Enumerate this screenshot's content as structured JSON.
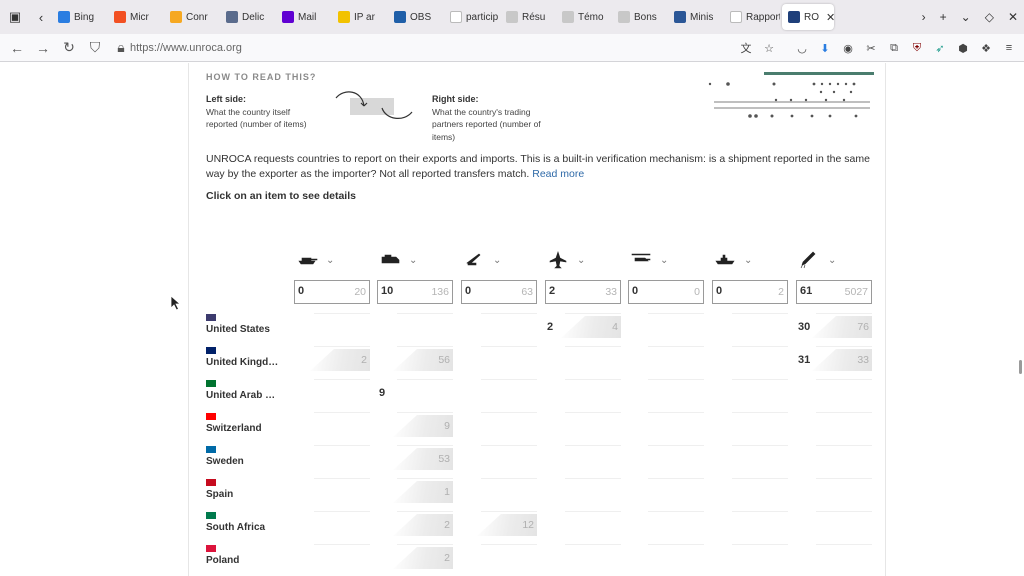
{
  "browser": {
    "tabs": [
      {
        "label": "Bing",
        "color": "#2a7de1"
      },
      {
        "label": "Micr",
        "color": "#f25022"
      },
      {
        "label": "Conr",
        "color": "#f6a821"
      },
      {
        "label": "Delic",
        "color": "#5a6b8c"
      },
      {
        "label": "Mail",
        "color": "#6001d2"
      },
      {
        "label": "IP ar",
        "color": "#f2c200"
      },
      {
        "label": "OBS",
        "color": "#1f5fa8"
      },
      {
        "label": "particip",
        "color": "#ffffff"
      },
      {
        "label": "Résu",
        "color": "#c8c8c8"
      },
      {
        "label": "Témo",
        "color": "#c8c8c8"
      },
      {
        "label": "Bons",
        "color": "#c8c8c8"
      },
      {
        "label": "Minis",
        "color": "#2b5797"
      },
      {
        "label": "Rapport",
        "color": "#ffffff"
      },
      {
        "label": "RO",
        "color": "#1f3f7a"
      }
    ],
    "url": "https://www.unroca.org"
  },
  "explainer": {
    "title": "HOW TO READ THIS?",
    "left_title": "Left side:",
    "left_text": "What the country itself reported (number of items)",
    "right_title": "Right side:",
    "right_text": "What the country's trading partners reported (number of items)",
    "intro": "UNROCA requests countries to report on their exports and imports. This is a built-in verification mechanism: is a shipment reported in the same way by the exporter as the importer? Not all reported transfers match.",
    "read_more": "Read more",
    "click_hint": "Click on an item to see details"
  },
  "categories": [
    {
      "icon": "tank-icon",
      "own": "0",
      "partners": "20"
    },
    {
      "icon": "armoured-vehicle-icon",
      "own": "10",
      "partners": "136"
    },
    {
      "icon": "artillery-icon",
      "own": "0",
      "partners": "63"
    },
    {
      "icon": "combat-aircraft-icon",
      "own": "2",
      "partners": "33"
    },
    {
      "icon": "helicopter-icon",
      "own": "0",
      "partners": "0"
    },
    {
      "icon": "warship-icon",
      "own": "0",
      "partners": "2"
    },
    {
      "icon": "missile-icon",
      "own": "61",
      "partners": "5027"
    }
  ],
  "countries": [
    {
      "name": "United States",
      "flag": "#3c3b6e",
      "cells": [
        null,
        null,
        null,
        {
          "own": "2",
          "partners": "4"
        },
        null,
        null,
        {
          "own": "30",
          "partners": "76"
        }
      ]
    },
    {
      "name": "United Kingd…",
      "flag": "#012169",
      "cells": [
        {
          "own": "",
          "partners": "2"
        },
        {
          "own": "",
          "partners": "56"
        },
        null,
        null,
        null,
        null,
        {
          "own": "31",
          "partners": "33"
        }
      ]
    },
    {
      "name": "United Arab …",
      "flag": "#00732f",
      "cells": [
        null,
        {
          "own": "9",
          "partners": ""
        },
        null,
        null,
        null,
        null,
        null
      ]
    },
    {
      "name": "Switzerland",
      "flag": "#ff0000",
      "cells": [
        null,
        {
          "own": "",
          "partners": "9"
        },
        null,
        null,
        null,
        null,
        null
      ]
    },
    {
      "name": "Sweden",
      "flag": "#006aa7",
      "cells": [
        null,
        {
          "own": "",
          "partners": "53"
        },
        null,
        null,
        null,
        null,
        null
      ]
    },
    {
      "name": "Spain",
      "flag": "#c60b1e",
      "cells": [
        null,
        {
          "own": "",
          "partners": "1"
        },
        null,
        null,
        null,
        null,
        null
      ]
    },
    {
      "name": "South Africa",
      "flag": "#007a4d",
      "cells": [
        null,
        {
          "own": "",
          "partners": "2"
        },
        {
          "own": "",
          "partners": "12"
        },
        null,
        null,
        null,
        null
      ]
    },
    {
      "name": "Poland",
      "flag": "#dc143c",
      "cells": [
        null,
        {
          "own": "",
          "partners": "2"
        },
        null,
        null,
        null,
        null,
        null
      ]
    }
  ]
}
